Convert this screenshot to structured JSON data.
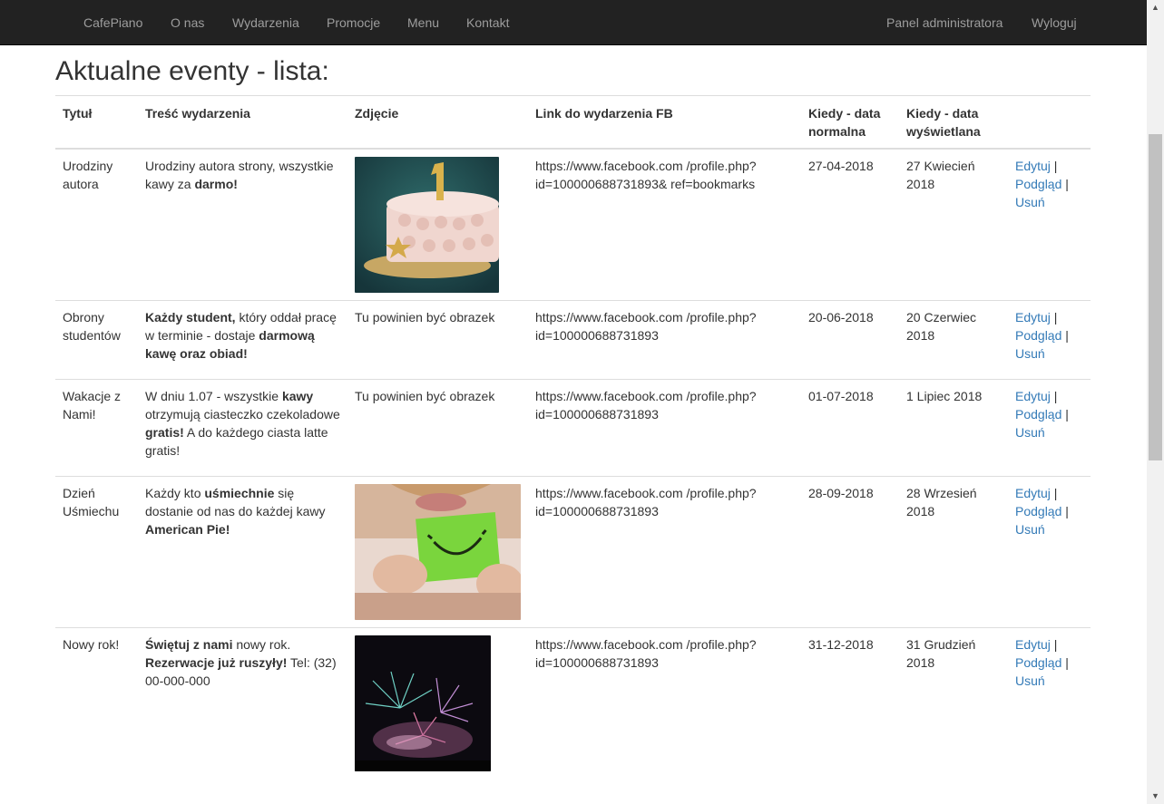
{
  "nav": {
    "brand": "CafePiano",
    "items": [
      "O nas",
      "Wydarzenia",
      "Promocje",
      "Menu",
      "Kontakt"
    ],
    "right": [
      "Panel administratora",
      "Wyloguj"
    ]
  },
  "page_title": "Aktualne eventy - lista:",
  "table": {
    "headers": [
      "Tytuł",
      "Treść wydarzenia",
      "Zdjęcie",
      "Link do wydarzenia FB",
      "Kiedy - data normalna",
      "Kiedy - data wyświetlana",
      ""
    ],
    "rows": [
      {
        "title": "Urodziny autora",
        "desc": [
          {
            "t": "Urodziny autora strony, wszystkie kawy za "
          },
          {
            "t": "darmo!",
            "b": true
          }
        ],
        "image": "birthday-cake-image",
        "image_alt": "",
        "link": "https://www.facebook.com /profile.php?id=100000688731893& ref=bookmarks",
        "date_normal": "27-04-2018",
        "date_display": "27 Kwiecień 2018"
      },
      {
        "title": "Obrony studentów",
        "desc": [
          {
            "t": "Każdy student,",
            "b": true
          },
          {
            "t": " który oddał pracę w terminie - dostaje "
          },
          {
            "t": "darmową kawę oraz obiad!",
            "b": true
          }
        ],
        "image": null,
        "image_alt": "Tu powinien być obrazek",
        "link": "https://www.facebook.com /profile.php?id=100000688731893",
        "date_normal": "20-06-2018",
        "date_display": "20 Czerwiec 2018"
      },
      {
        "title": "Wakacje z Nami!",
        "desc": [
          {
            "t": "W dniu 1.07 - wszystkie "
          },
          {
            "t": "kawy",
            "b": true
          },
          {
            "t": " otrzymują ciasteczko czekoladowe "
          },
          {
            "t": "gratis!",
            "b": true
          },
          {
            "t": " A do każdego ciasta latte gratis!"
          }
        ],
        "image": null,
        "image_alt": "Tu powinien być obrazek",
        "link": "https://www.facebook.com /profile.php?id=100000688731893",
        "date_normal": "01-07-2018",
        "date_display": "1 Lipiec 2018"
      },
      {
        "title": "Dzień Uśmiechu",
        "desc": [
          {
            "t": "Każdy kto "
          },
          {
            "t": "uśmiechnie",
            "b": true
          },
          {
            "t": " się dostanie od nas do każdej kawy "
          },
          {
            "t": "American Pie!",
            "b": true
          }
        ],
        "image": "smile-card-image",
        "image_alt": "",
        "link": "https://www.facebook.com /profile.php?id=100000688731893",
        "date_normal": "28-09-2018",
        "date_display": "28 Wrzesień 2018"
      },
      {
        "title": "Nowy rok!",
        "desc": [
          {
            "t": "Świętuj z nami",
            "b": true
          },
          {
            "t": " nowy rok. "
          },
          {
            "t": "Rezerwacje już ruszyły!",
            "b": true
          },
          {
            "t": " Tel: (32) 00-000-000"
          }
        ],
        "image": "fireworks-image",
        "image_alt": "",
        "link": "https://www.facebook.com /profile.php?id=100000688731893",
        "date_normal": "31-12-2018",
        "date_display": "31 Grudzień 2018"
      }
    ],
    "actions": {
      "edit": "Edytuj",
      "preview": "Podgląd",
      "delete": "Usuń",
      "separator": "|"
    }
  },
  "colors": {
    "navbar": "#222222",
    "nav_text": "#9d9d9d",
    "link": "#337ab7",
    "border": "#dddddd"
  }
}
